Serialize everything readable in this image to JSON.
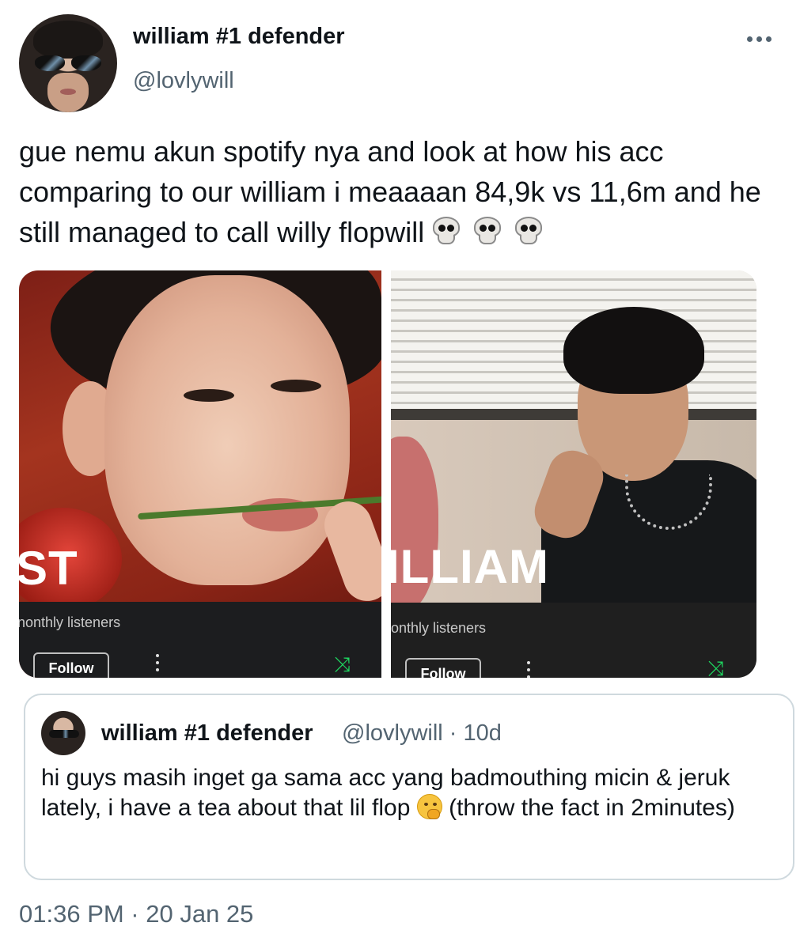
{
  "author": {
    "display_name": "william #1 defender",
    "handle": "@lovlywill"
  },
  "tweet": {
    "text": "gue nemu akun spotify nya and look at how his acc comparing to our william i meaaaan 84,9k vs 11,6m and he still managed to call willy flopwill",
    "emojis": [
      "skull-icon",
      "skull-icon",
      "skull-icon"
    ],
    "timestamp": "01:36 PM · 20 Jan 25"
  },
  "media": {
    "left": {
      "artist_name_fragment": "ST",
      "listeners_label": "nonthly listeners",
      "follow_label": "Follow"
    },
    "right": {
      "artist_name_fragment": "ILLIAM",
      "listeners_label": "onthly listeners",
      "follow_label": "Follow"
    },
    "accent_color": "#1ed760"
  },
  "quoted_tweet": {
    "display_name": "william #1 defender",
    "meta": "@lovlywill · 10d",
    "text_before_emoji": "hi guys masih inget ga sama acc yang badmouthing micin & jeruk lately, i have a tea about that lil flop",
    "emoji": "shushing-face-icon",
    "text_after_emoji": "(throw the fact in 2minutes)"
  },
  "colors": {
    "text_primary": "#0f1419",
    "text_secondary": "#536471",
    "quote_border": "#cfd9de"
  }
}
